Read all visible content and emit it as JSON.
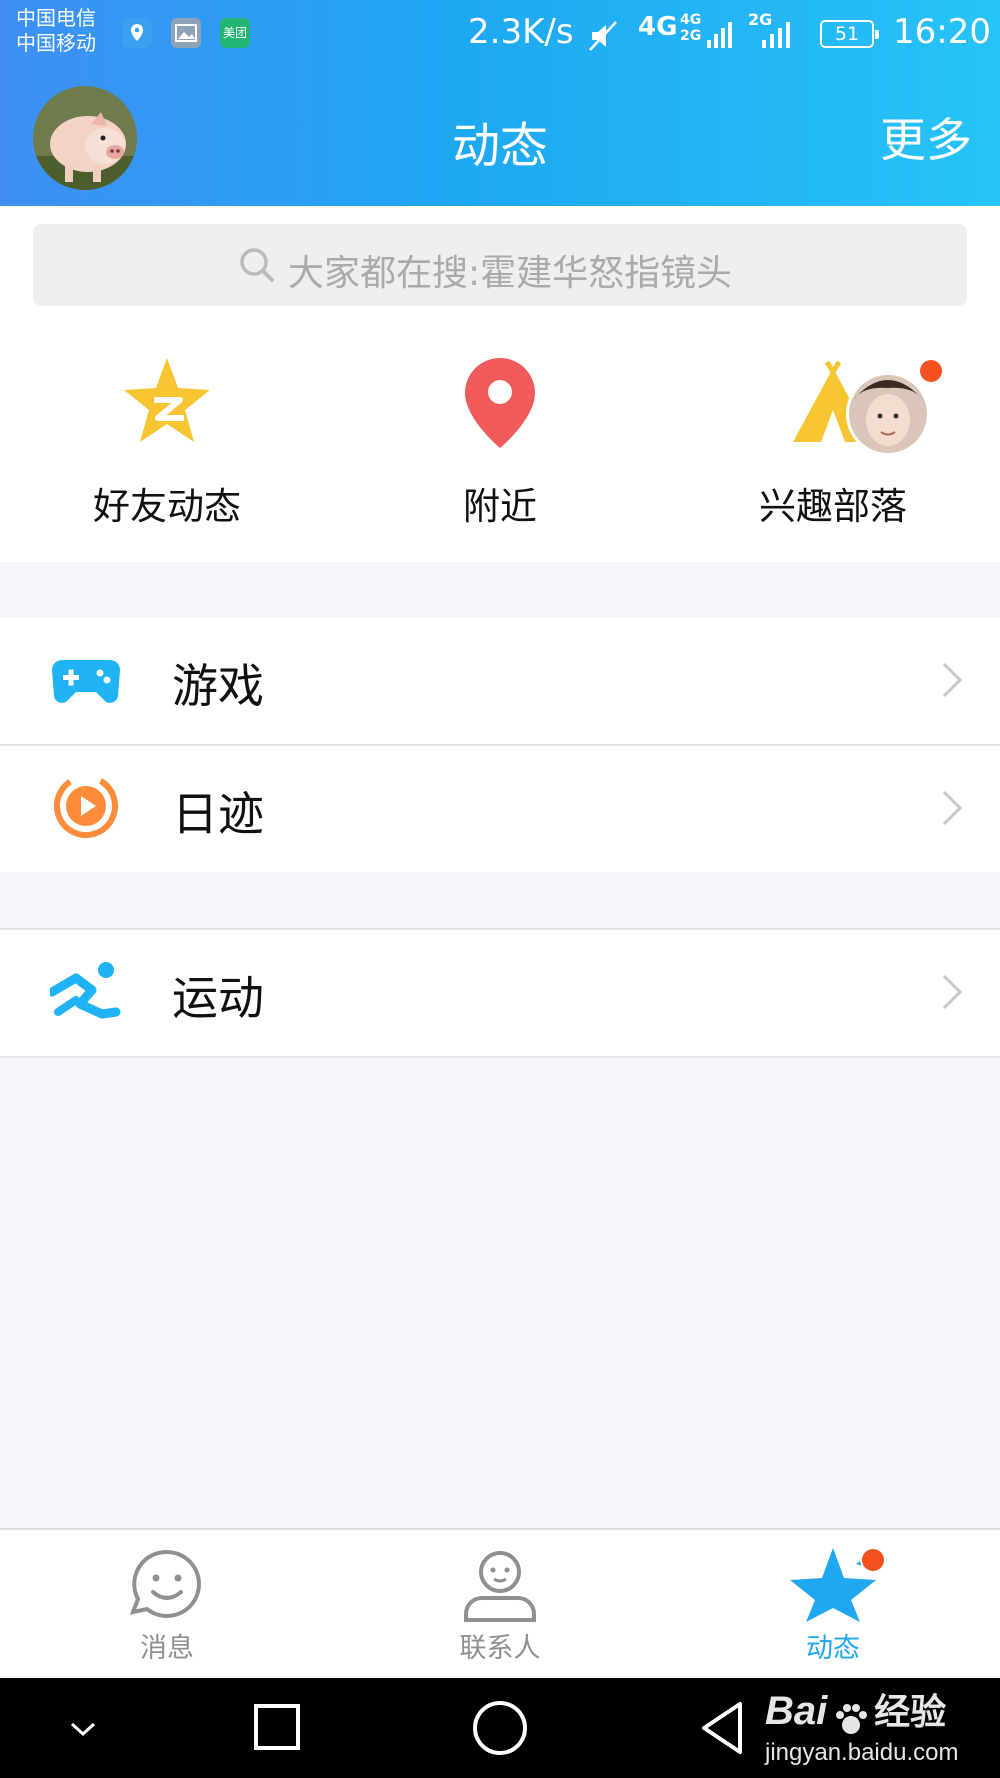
{
  "status_bar": {
    "carrier_1": "中国电信",
    "carrier_2": "中国移动",
    "meituan_label": "美团",
    "speed": "2.3K/s",
    "network_1": "4G",
    "network_2a": "4G",
    "network_2b": "2G",
    "network_3": "2G",
    "battery": "51",
    "time": "16:20"
  },
  "header": {
    "title": "动态",
    "more_label": "更多"
  },
  "search": {
    "placeholder": "大家都在搜:霍建华怒指镜头"
  },
  "quick_links": [
    {
      "label": "好友动态",
      "icon": "friends-star-icon",
      "color": "#f7c531"
    },
    {
      "label": "附近",
      "icon": "location-pin-icon",
      "color": "#f05a5a"
    },
    {
      "label": "兴趣部落",
      "icon": "tribe-tent-icon",
      "color": "#f7c531"
    }
  ],
  "list_items": [
    {
      "label": "游戏",
      "icon": "gamepad-icon",
      "color": "#1fb3f5"
    },
    {
      "label": "日迹",
      "icon": "play-circle-icon",
      "color": "#ff8c3b"
    },
    {
      "label": "运动",
      "icon": "running-icon",
      "color": "#1fb3f5"
    }
  ],
  "tabs": [
    {
      "label": "消息",
      "icon": "smiley-chat-icon",
      "active": false
    },
    {
      "label": "联系人",
      "icon": "person-icon",
      "active": false
    },
    {
      "label": "动态",
      "icon": "star-icon",
      "active": true
    }
  ],
  "colors": {
    "accent": "#1fa7f2",
    "badge": "#f4511e",
    "tab_inactive": "#8f8f94"
  },
  "watermark": {
    "brand": "Bai",
    "brand_suffix": "经验",
    "url": "jingyan.baidu.com"
  }
}
